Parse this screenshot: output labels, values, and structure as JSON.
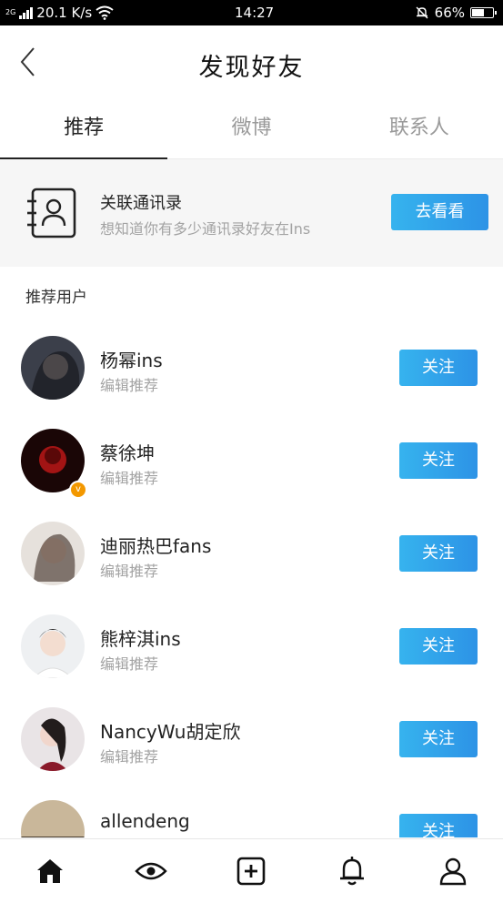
{
  "status_bar": {
    "network": "2G",
    "speed": "20.1 K/s",
    "time": "14:27",
    "battery": "66%",
    "battery_level": 0.66
  },
  "header": {
    "title": "发现好友"
  },
  "tabs": [
    {
      "label": "推荐",
      "active": true
    },
    {
      "label": "微博",
      "active": false
    },
    {
      "label": "联系人",
      "active": false
    }
  ],
  "contacts_banner": {
    "title": "关联通讯录",
    "subtitle": "想知道你有多少通讯录好友在Ins",
    "button_label": "去看看"
  },
  "section_title": "推荐用户",
  "users": [
    {
      "name": "杨幂ins",
      "subtitle": "编辑推荐",
      "follow_label": "关注",
      "verified": false
    },
    {
      "name": "蔡徐坤",
      "subtitle": "编辑推荐",
      "follow_label": "关注",
      "verified": true
    },
    {
      "name": "迪丽热巴fans",
      "subtitle": "编辑推荐",
      "follow_label": "关注",
      "verified": false
    },
    {
      "name": "熊梓淇ins",
      "subtitle": "编辑推荐",
      "follow_label": "关注",
      "verified": false
    },
    {
      "name": "NancyWu胡定欣",
      "subtitle": "编辑推荐",
      "follow_label": "关注",
      "verified": false
    },
    {
      "name": "allendeng",
      "subtitle": "",
      "follow_label": "关注",
      "verified": false
    }
  ],
  "bottom_nav": [
    "home-icon",
    "eye-icon",
    "plus-square-icon",
    "bell-icon",
    "user-icon"
  ],
  "colors": {
    "accent": "#2d9ae8",
    "verified": "#f39800"
  }
}
